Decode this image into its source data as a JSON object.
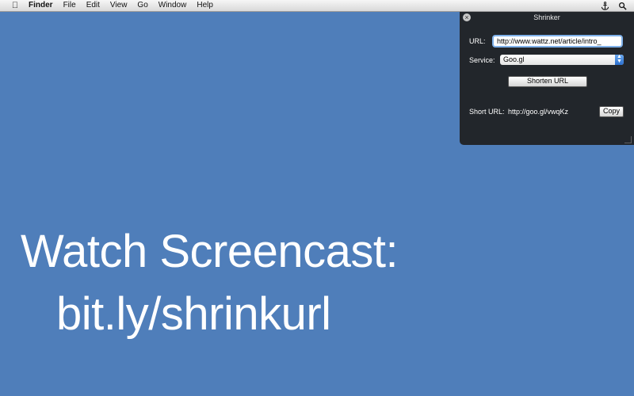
{
  "menubar": {
    "apple_icon": "apple-icon",
    "app_name": "Finder",
    "items": [
      "File",
      "Edit",
      "View",
      "Go",
      "Window",
      "Help"
    ],
    "status_icons": [
      "anchor-icon",
      "spotlight-search-icon"
    ]
  },
  "desktop": {
    "line1": "Watch Screencast:",
    "line2": "bit.ly/shrinkurl",
    "background_color": "#4f7eba"
  },
  "panel": {
    "title": "Shrinker",
    "url_label": "URL:",
    "url_value": "http://www.wattz.net/article/intro_",
    "service_label": "Service:",
    "service_value": "Goo.gl",
    "shorten_button": "Shorten URL",
    "short_url_label": "Short URL:",
    "short_url_value": "http://goo.gl/vwqKz",
    "copy_button": "Copy"
  }
}
